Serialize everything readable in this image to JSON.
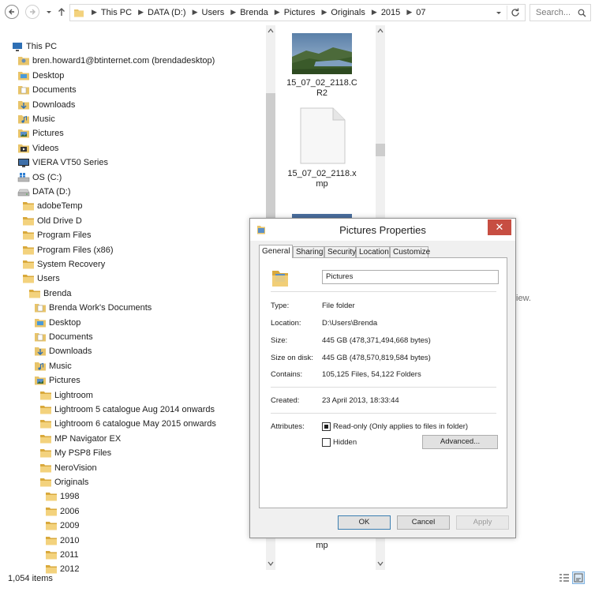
{
  "address": {
    "crumbs": [
      "This PC",
      "DATA (D:)",
      "Users",
      "Brenda",
      "Pictures",
      "Originals",
      "2015",
      "07"
    ],
    "search_placeholder": "Search..."
  },
  "tree": [
    {
      "label": "This PC",
      "indent": 0,
      "icon": "pc-icon"
    },
    {
      "label": "bren.howard1@btinternet.com (brendadesktop)",
      "indent": 1,
      "icon": "user-folder-icon"
    },
    {
      "label": "Desktop",
      "indent": 1,
      "icon": "desktop-folder-icon"
    },
    {
      "label": "Documents",
      "indent": 1,
      "icon": "documents-folder-icon"
    },
    {
      "label": "Downloads",
      "indent": 1,
      "icon": "downloads-folder-icon"
    },
    {
      "label": "Music",
      "indent": 1,
      "icon": "music-folder-icon"
    },
    {
      "label": "Pictures",
      "indent": 1,
      "icon": "pictures-folder-icon"
    },
    {
      "label": "Videos",
      "indent": 1,
      "icon": "videos-folder-icon"
    },
    {
      "label": "VIERA VT50 Series",
      "indent": 1,
      "icon": "media-device-icon"
    },
    {
      "label": "OS (C:)",
      "indent": 1,
      "icon": "windows-drive-icon"
    },
    {
      "label": "DATA (D:)",
      "indent": 1,
      "icon": "drive-icon"
    },
    {
      "label": "adobeTemp",
      "indent": 2,
      "icon": "folder-icon"
    },
    {
      "label": "Old Drive D",
      "indent": 2,
      "icon": "folder-icon"
    },
    {
      "label": "Program Files",
      "indent": 2,
      "icon": "folder-icon"
    },
    {
      "label": "Program Files (x86)",
      "indent": 2,
      "icon": "folder-icon"
    },
    {
      "label": "System Recovery",
      "indent": 2,
      "icon": "folder-icon"
    },
    {
      "label": "Users",
      "indent": 2,
      "icon": "folder-icon"
    },
    {
      "label": "Brenda",
      "indent": 3,
      "icon": "folder-icon"
    },
    {
      "label": "Brenda Work's Documents",
      "indent": 4,
      "icon": "documents-folder-icon"
    },
    {
      "label": "Desktop",
      "indent": 4,
      "icon": "desktop-folder-icon"
    },
    {
      "label": "Documents",
      "indent": 4,
      "icon": "documents-folder-icon"
    },
    {
      "label": "Downloads",
      "indent": 4,
      "icon": "downloads-folder-icon"
    },
    {
      "label": "Music",
      "indent": 4,
      "icon": "music-folder-icon"
    },
    {
      "label": "Pictures",
      "indent": 4,
      "icon": "pictures-folder-icon"
    },
    {
      "label": "Lightroom",
      "indent": 5,
      "icon": "folder-icon"
    },
    {
      "label": "Lightroom 5 catalogue Aug 2014 onwards",
      "indent": 5,
      "icon": "folder-icon"
    },
    {
      "label": "Lightroom 6 catalogue May 2015 onwards",
      "indent": 5,
      "icon": "folder-icon"
    },
    {
      "label": "MP Navigator EX",
      "indent": 5,
      "icon": "folder-icon"
    },
    {
      "label": "My PSP8 Files",
      "indent": 5,
      "icon": "folder-icon"
    },
    {
      "label": "NeroVision",
      "indent": 5,
      "icon": "folder-icon"
    },
    {
      "label": "Originals",
      "indent": 5,
      "icon": "folder-icon"
    },
    {
      "label": "1998",
      "indent": 6,
      "icon": "folder-icon"
    },
    {
      "label": "2006",
      "indent": 6,
      "icon": "folder-icon"
    },
    {
      "label": "2009",
      "indent": 6,
      "icon": "folder-icon"
    },
    {
      "label": "2010",
      "indent": 6,
      "icon": "folder-icon"
    },
    {
      "label": "2011",
      "indent": 6,
      "icon": "folder-icon"
    },
    {
      "label": "2012",
      "indent": 6,
      "icon": "folder-icon"
    }
  ],
  "files": {
    "cr2_label": "15_07_02_2118.CR2",
    "xmp_label": "15_07_02_2118.xmp",
    "partial_label": "mp",
    "hidden_text": "iew."
  },
  "status": {
    "item_count": "1,054 items"
  },
  "dialog": {
    "title": "Pictures Properties",
    "close": "✕",
    "tabs": [
      "General",
      "Sharing",
      "Security",
      "Location",
      "Customize"
    ],
    "name": "Pictures",
    "type_label": "Type:",
    "type_value": "File folder",
    "location_label": "Location:",
    "location_value": "D:\\Users\\Brenda",
    "size_label": "Size:",
    "size_value": "445 GB (478,371,494,668 bytes)",
    "size_disk_label": "Size on disk:",
    "size_disk_value": "445 GB (478,570,819,584 bytes)",
    "contains_label": "Contains:",
    "contains_value": "105,125 Files, 54,122 Folders",
    "created_label": "Created:",
    "created_value": "23 April 2013, 18:33:44",
    "attributes_label": "Attributes:",
    "readonly_label": "Read-only (Only applies to files in folder)",
    "hidden_label": "Hidden",
    "advanced_label": "Advanced...",
    "ok_label": "OK",
    "cancel_label": "Cancel",
    "apply_label": "Apply"
  },
  "colors": {
    "folder": "#e8c46a",
    "folder_dark": "#d9a93c",
    "close_red": "#c74e42",
    "accent_blue": "#3c7fb1"
  }
}
